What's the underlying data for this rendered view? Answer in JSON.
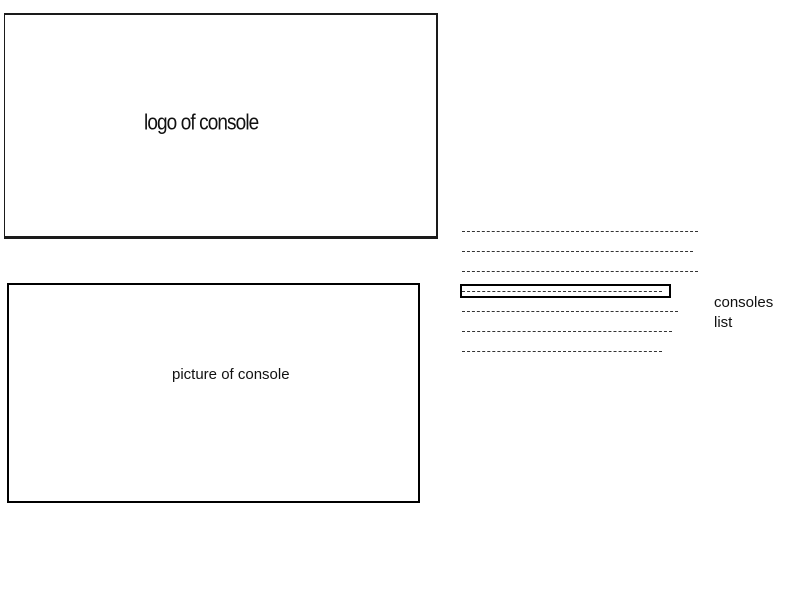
{
  "logo_box": {
    "label": "logo of console"
  },
  "picture_box": {
    "label": "picture of console"
  },
  "consoles_list": {
    "label_lines": [
      "consoles",
      "list"
    ],
    "item_count": 7,
    "selected_index": 3
  }
}
